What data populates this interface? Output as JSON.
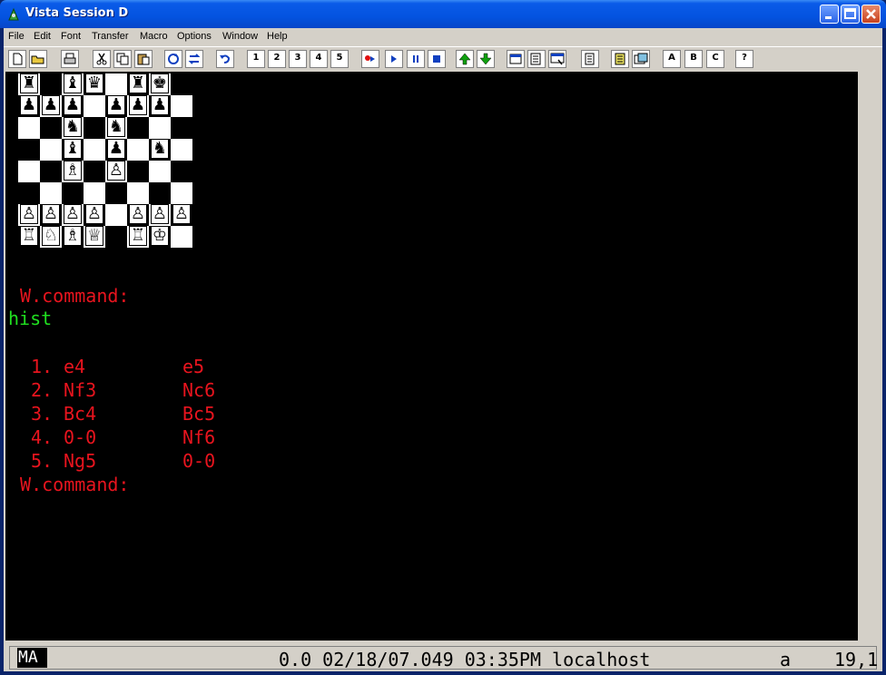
{
  "window": {
    "title": "Vista Session D"
  },
  "menu": [
    "File",
    "Edit",
    "Font",
    "Transfer",
    "Macro",
    "Options",
    "Window",
    "Help"
  ],
  "toolbar": {
    "macro_labels": [
      "1",
      "2",
      "3",
      "4",
      "5"
    ],
    "letter_labels": [
      "A",
      "B",
      "C"
    ],
    "help_label": "?"
  },
  "chess": {
    "pieces": {
      "r": "♜",
      "n": "♞",
      "b": "♝",
      "q": "♛",
      "k": "♚",
      "p": "♟",
      "R": "♖",
      "N": "♘",
      "B": "♗",
      "Q": "♕",
      "K": "♔",
      "P": "♙"
    },
    "ranks": [
      "r.bq.rk.",
      "ppp.ppp.",
      "..n.n...",
      "..b.p.n.",
      "..B.P...",
      "........",
      "PPPP.PPP",
      "RNBQ.RK."
    ]
  },
  "terminal": {
    "prompt1": " W.command:",
    "input": "hist",
    "moves": [
      {
        "num": "1.",
        "white": "e4",
        "black": "e5"
      },
      {
        "num": "2.",
        "white": "Nf3",
        "black": "Nc6"
      },
      {
        "num": "3.",
        "white": "Bc4",
        "black": "Bc5"
      },
      {
        "num": "4.",
        "white": "0-0",
        "black": "Nf6"
      },
      {
        "num": "5.",
        "white": "Ng5",
        "black": "0-0"
      }
    ],
    "prompt2": " W.command:"
  },
  "status": {
    "mode": "MA",
    "info": "0.0 02/18/07.049 03:35PM localhost",
    "char": "a",
    "cursor": "19,1"
  }
}
